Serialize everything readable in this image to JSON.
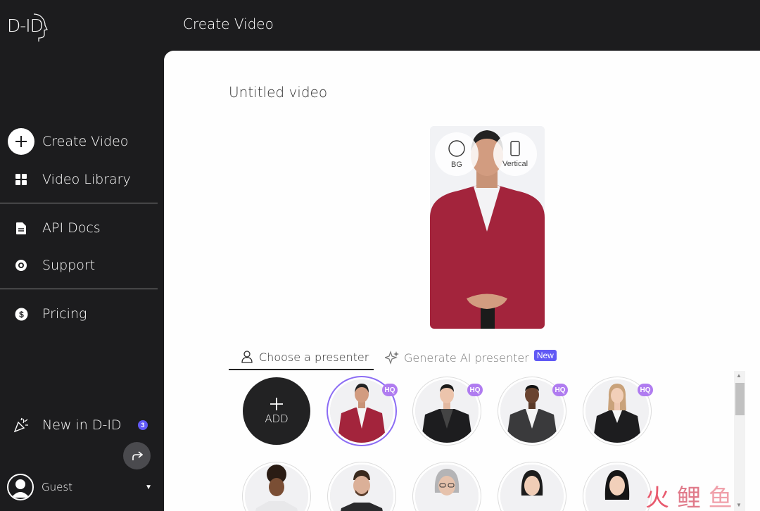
{
  "brand": {
    "logo_text": "D-ID"
  },
  "header": {
    "title": "Create Video"
  },
  "sidebar": {
    "items": [
      {
        "label": "Create Video",
        "icon": "plus-circle-icon"
      },
      {
        "label": "Video Library",
        "icon": "grid-icon"
      },
      {
        "label": "API Docs",
        "icon": "document-icon"
      },
      {
        "label": "Support",
        "icon": "lifebuoy-icon"
      },
      {
        "label": "Pricing",
        "icon": "dollar-icon"
      }
    ],
    "whats_new": {
      "label": "New in D-ID",
      "count": "3"
    },
    "user": {
      "name": "Guest"
    }
  },
  "main": {
    "video_title": "Untitled video",
    "preview_options": {
      "bg_label": "BG",
      "vertical_label": "Vertical"
    },
    "tabs": {
      "choose": "Choose a presenter",
      "generate": "Generate AI presenter",
      "new_badge": "New"
    },
    "add_label": "ADD",
    "hq_badge": "HQ"
  },
  "watermark": {
    "glyphs": [
      "火",
      "鲤",
      "鱼"
    ]
  },
  "colors": {
    "accent": "#6159f5",
    "hq_badge": "#b07cf0",
    "selected_ring": "#8b6cf4",
    "sidebar_bg": "#1c1c1e"
  }
}
